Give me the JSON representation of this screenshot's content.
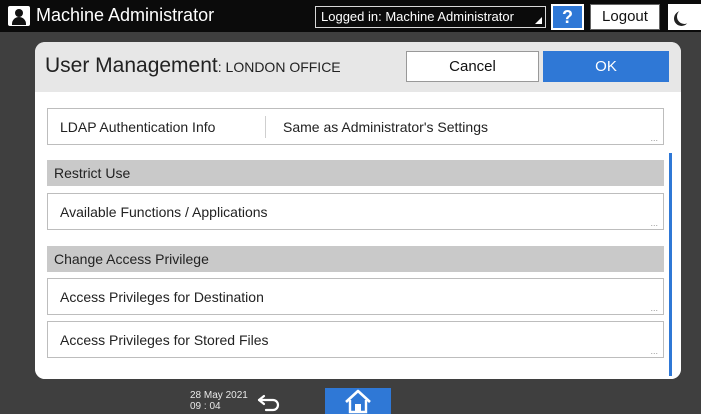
{
  "topbar": {
    "machine_title": "Machine Administrator",
    "login_status": "Logged in: Machine Administrator",
    "help_label": "?",
    "logout_label": "Logout"
  },
  "dialog": {
    "title": "User Management",
    "subtitle": ": LONDON OFFICE",
    "cancel_label": "Cancel",
    "ok_label": "OK",
    "rows": [
      {
        "label": "LDAP Authentication Info",
        "value": "Same as Administrator's Settings"
      }
    ],
    "sections": [
      {
        "header": "Restrict Use",
        "items": [
          "Available Functions / Applications"
        ]
      },
      {
        "header": "Change Access Privilege",
        "items": [
          "Access Privileges for Destination",
          "Access Privileges for Stored Files"
        ]
      }
    ],
    "ellipsis": "..."
  },
  "bottombar": {
    "date": "28 May 2021",
    "time": "09 : 04"
  },
  "colors": {
    "accent": "#2f78d6",
    "topbar": "#0b0b0b",
    "section_bg": "#c9c9c9"
  }
}
